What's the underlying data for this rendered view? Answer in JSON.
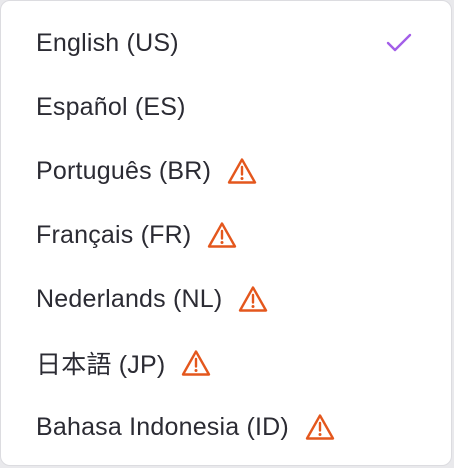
{
  "language_menu": {
    "items": [
      {
        "label": "English (US)",
        "selected": true,
        "warning": false
      },
      {
        "label": "Español (ES)",
        "selected": false,
        "warning": false
      },
      {
        "label": "Português (BR)",
        "selected": false,
        "warning": true
      },
      {
        "label": "Français (FR)",
        "selected": false,
        "warning": true
      },
      {
        "label": "Nederlands (NL)",
        "selected": false,
        "warning": true
      },
      {
        "label": "日本語 (JP)",
        "selected": false,
        "warning": true
      },
      {
        "label": "Bahasa Indonesia (ID)",
        "selected": false,
        "warning": true
      }
    ],
    "icons": {
      "selected": "checkmark-icon",
      "warning": "warning-triangle-icon"
    },
    "colors": {
      "check": "#a35ee8",
      "warning": "#e4571d",
      "text": "#2b2b33"
    }
  }
}
